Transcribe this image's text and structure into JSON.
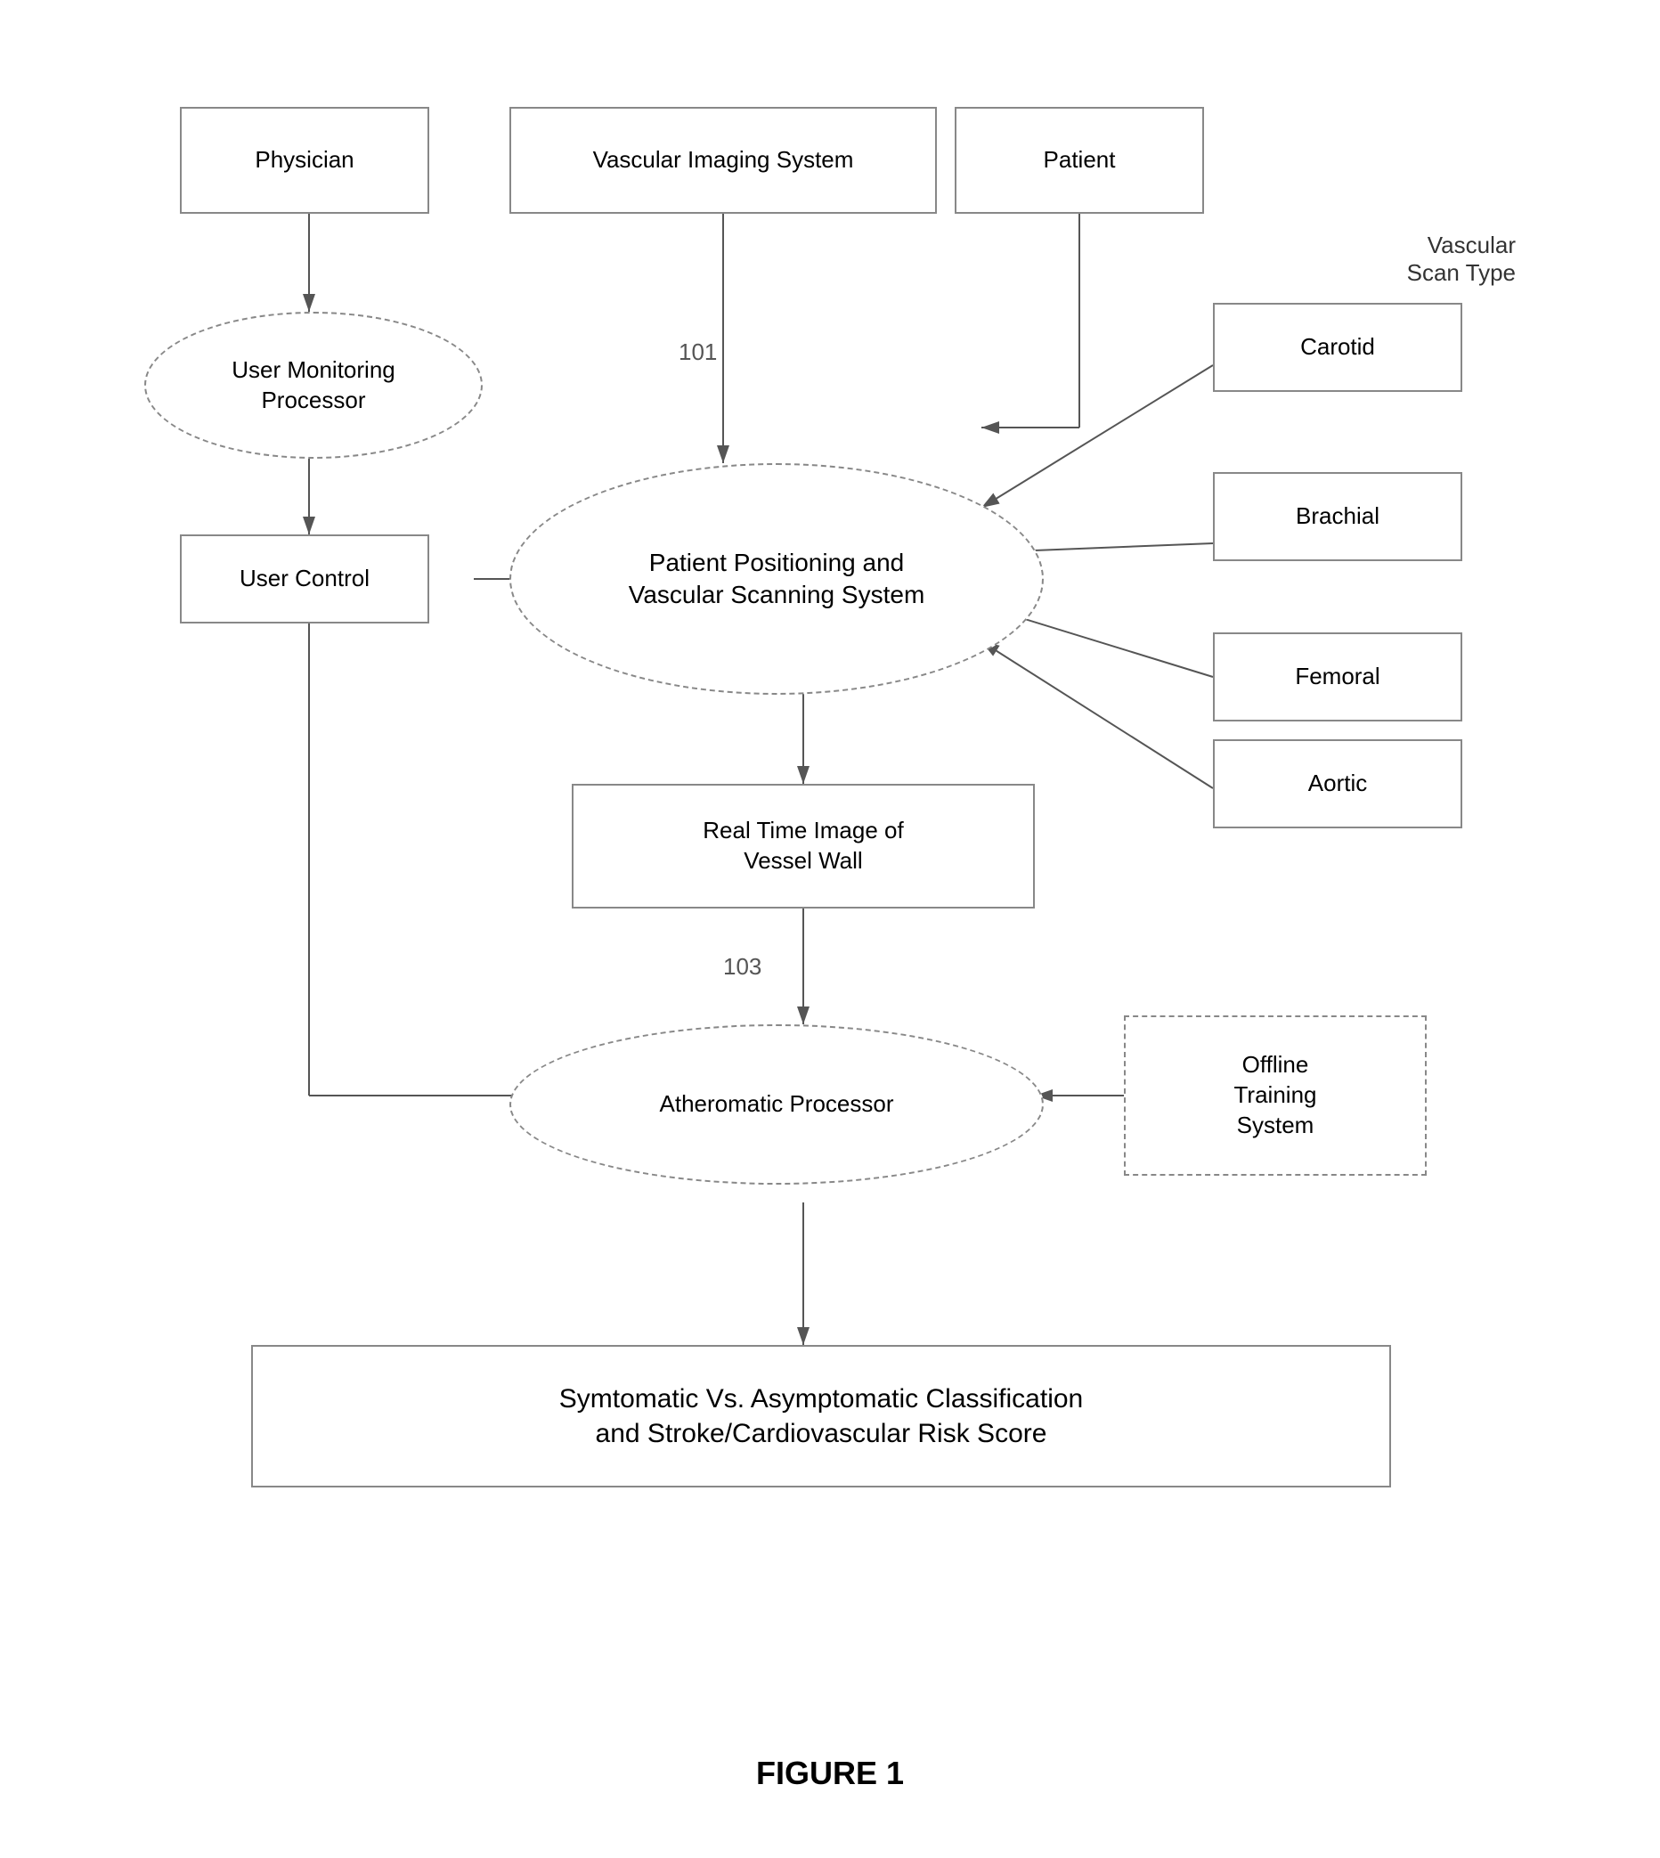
{
  "diagram": {
    "title": "FIGURE 1",
    "nodes": {
      "physician": {
        "label": "Physician"
      },
      "vascular_imaging": {
        "label": "Vascular Imaging System"
      },
      "patient": {
        "label": "Patient"
      },
      "user_monitoring": {
        "label": "User Monitoring\nProcessor"
      },
      "user_control": {
        "label": "User Control"
      },
      "patient_positioning": {
        "label": "Patient Positioning and\nVascular Scanning System"
      },
      "real_time_image": {
        "label": "Real Time Image of\nVessel Wall"
      },
      "atheromatic": {
        "label": "Atheromatic Processor"
      },
      "classification": {
        "label": "Symtomatic Vs. Asymptomatic Classification\nand Stroke/Cardiovascular Risk Score"
      },
      "carotid": {
        "label": "Carotid"
      },
      "brachial": {
        "label": "Brachial"
      },
      "femoral": {
        "label": "Femoral"
      },
      "aortic": {
        "label": "Aortic"
      },
      "offline_training": {
        "label": "Offline\nTraining\nSystem"
      },
      "vascular_scan_type": {
        "label": "Vascular\nScan Type"
      }
    },
    "refs": {
      "ref101": "101",
      "ref103": "103"
    }
  }
}
